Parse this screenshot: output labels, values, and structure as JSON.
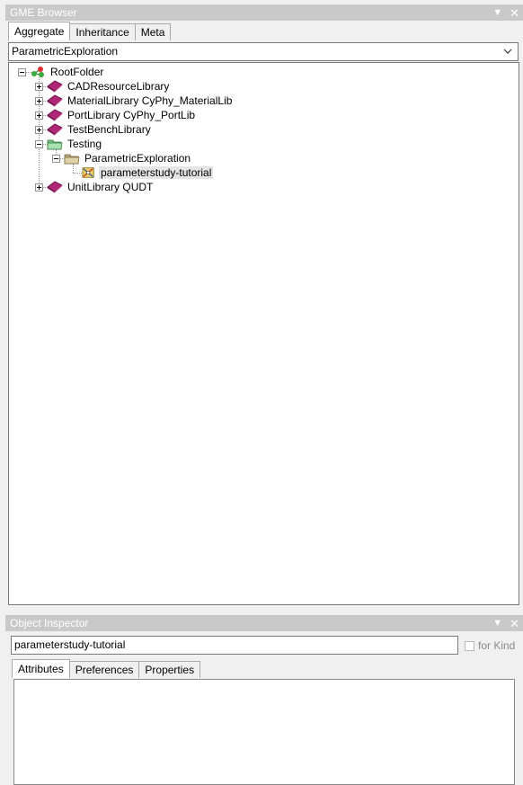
{
  "browser": {
    "title": "GME Browser",
    "tabs": [
      {
        "label": "Aggregate",
        "active": true
      },
      {
        "label": "Inheritance",
        "active": false
      },
      {
        "label": "Meta",
        "active": false
      }
    ],
    "combo_value": "ParametricExploration",
    "tree": {
      "root": "RootFolder",
      "items": [
        "CADResourceLibrary",
        "MaterialLibrary CyPhy_MaterialLib",
        "PortLibrary CyPhy_PortLib",
        "TestBenchLibrary",
        "Testing",
        "ParametricExploration",
        "parameterstudy-tutorial",
        "UnitLibrary QUDT"
      ]
    }
  },
  "inspector": {
    "title": "Object Inspector",
    "name_value": "parameterstudy-tutorial",
    "for_kind_label": "for Kind",
    "tabs": [
      {
        "label": "Attributes",
        "active": true
      },
      {
        "label": "Preferences",
        "active": false
      },
      {
        "label": "Properties",
        "active": false
      }
    ]
  },
  "colors": {
    "title_bar": "#c9c9c9",
    "library_icon": "#b0267a",
    "folder_icon": "#c8b88a",
    "testing_folder_icon": "#6ec27a",
    "selection": "#e5e5e5"
  }
}
